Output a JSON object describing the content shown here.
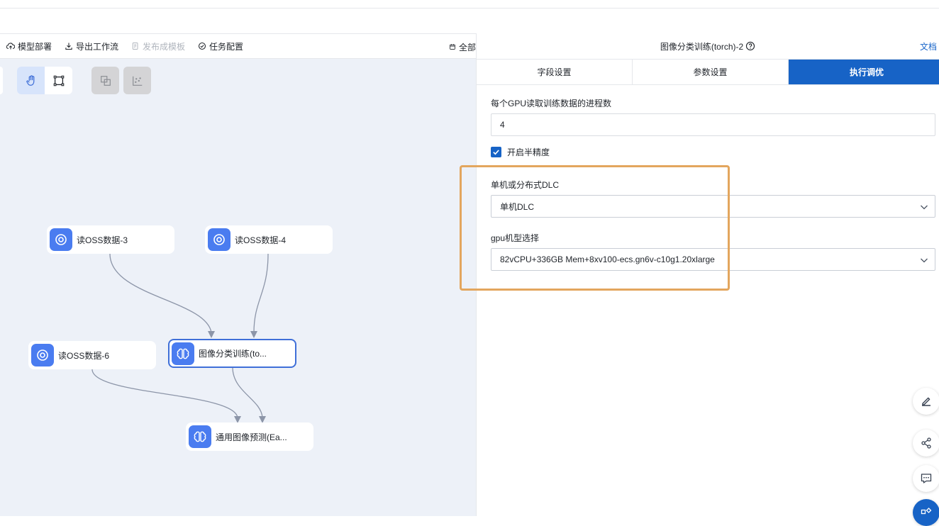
{
  "toolbar": {
    "model_deploy": "模型部署",
    "export_workflow": "导出工作流",
    "publish_template": "发布成模板",
    "task_config": "任务配置",
    "all": "全部"
  },
  "nodes": {
    "oss3": "读OSS数据-3",
    "oss4": "读OSS数据-4",
    "oss6": "读OSS数据-6",
    "train": "图像分类训练(to...",
    "predict": "通用图像预测(Ea..."
  },
  "panel": {
    "title": "图像分类训练(torch)-2",
    "doc": "文档",
    "tabs": [
      "字段设置",
      "参数设置",
      "执行调优"
    ],
    "active_tab": "执行调优"
  },
  "form": {
    "workers_label": "每个GPU读取训练数据的进程数",
    "workers_value": "4",
    "half_precision_label": "开启半精度",
    "half_precision_checked": true,
    "dlc_label": "单机或分布式DLC",
    "dlc_value": "单机DLC",
    "gpu_label": "gpu机型选择",
    "gpu_value": "82vCPU+336GB Mem+8xv100-ecs.gn6v-c10g1.20xlarge"
  },
  "colors": {
    "accent": "#1763c6",
    "node_icon": "#4a7cf0",
    "highlight": "#e3a65e",
    "canvas": "#edf1f8"
  }
}
